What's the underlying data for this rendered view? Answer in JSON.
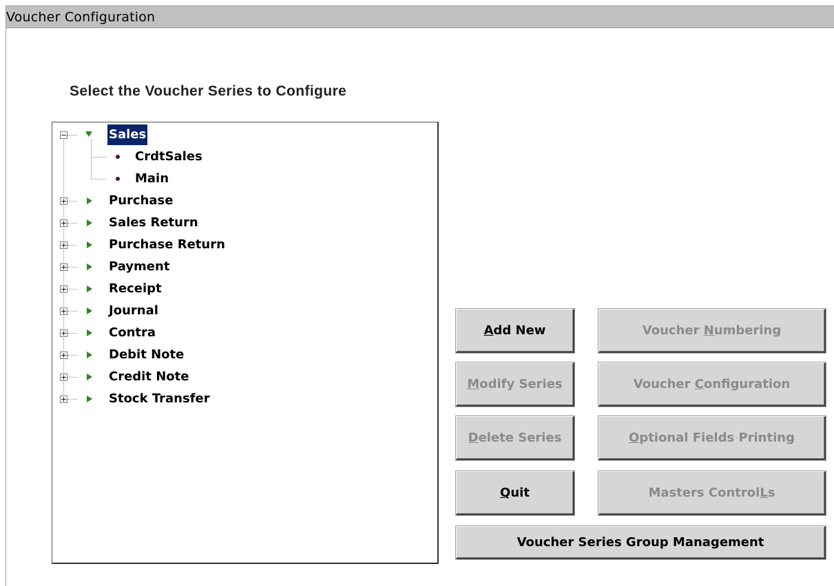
{
  "window": {
    "title": "Voucher Configuration"
  },
  "heading": "Select the Voucher Series to Configure",
  "tree": {
    "sales": {
      "label": "Sales",
      "children": [
        "CrdtSales",
        "Main"
      ]
    },
    "groups": [
      "Purchase",
      "Sales Return",
      "Purchase Return",
      "Payment",
      "Receipt",
      "Journal",
      "Contra",
      "Debit Note",
      "Credit Note",
      "Stock Transfer"
    ]
  },
  "buttons": {
    "add_new": {
      "label": "Add New",
      "mnemonic": "A",
      "rest": "dd New"
    },
    "modify_series": {
      "mnemonic": "M",
      "rest": "odify Series"
    },
    "delete_series": {
      "mnemonic": "D",
      "rest": "elete Series"
    },
    "quit": {
      "mnemonic": "Q",
      "rest": "uit"
    },
    "voucher_numbering": {
      "pre": "Voucher ",
      "mnemonic": "N",
      "rest": "umbering"
    },
    "voucher_configuration": {
      "pre": "Voucher ",
      "mnemonic": "C",
      "rest": "onfiguration"
    },
    "optional_fields_printing": {
      "mnemonic": "O",
      "rest": "ptional Fields Printing"
    },
    "masters_controls": {
      "pre": "Masters Control",
      "mnemonic": "L",
      "rest": "s"
    },
    "voucher_series_group_management": {
      "label": "Voucher Series Group Management"
    }
  },
  "colors": {
    "selection": "#0a246a",
    "arrow": "#2a8a1a",
    "bullet": "#4a1a1a",
    "disabled_text": "#8a8a8a"
  },
  "icons": {
    "collapse": "minus-box-icon",
    "expand": "plus-box-icon",
    "expanded_arrow": "triangle-down-icon",
    "collapsed_arrow": "triangle-right-icon",
    "leaf": "bullet-icon"
  }
}
